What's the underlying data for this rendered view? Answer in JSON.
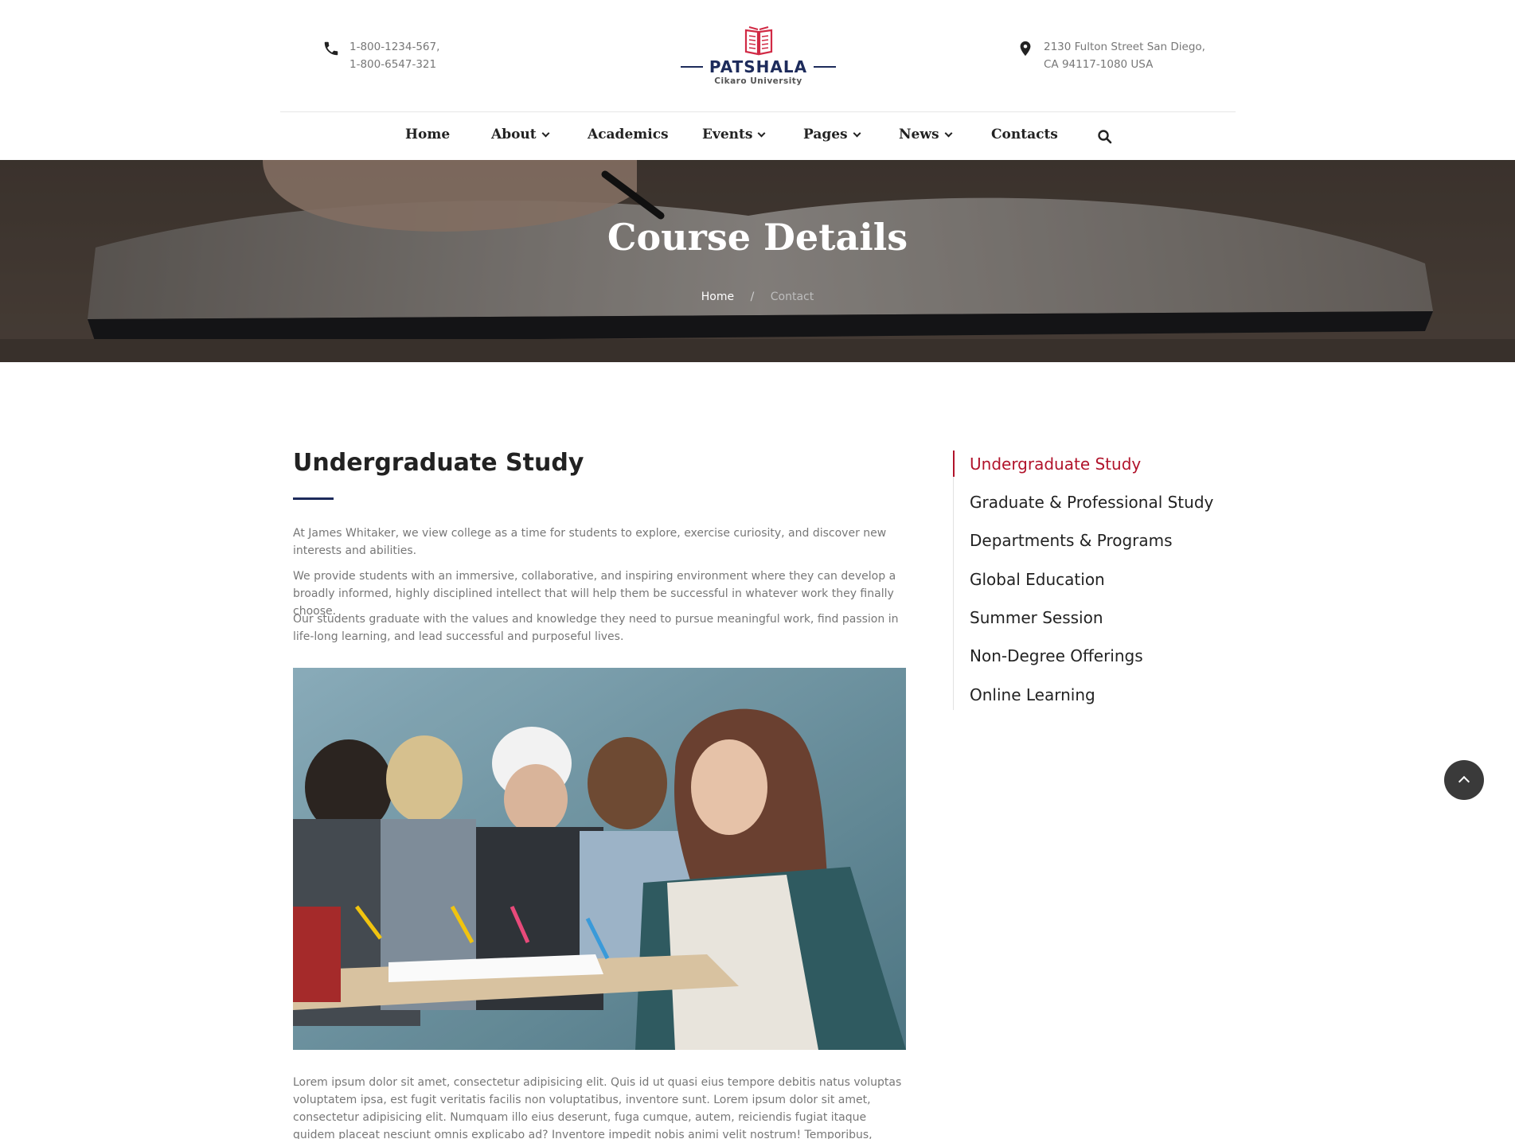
{
  "header": {
    "phone_lines": [
      "1-800-1234-567,",
      "1-800-6547-321"
    ],
    "address_lines": [
      "2130 Fulton Street San Diego,",
      "CA 94117-1080 USA"
    ],
    "logo_name": "PATSHALA",
    "logo_tagline": "Cikaro University",
    "phone_icon": "phone-icon",
    "address_icon": "map-pin-icon",
    "brand_color": "#1d2b5b",
    "accent_color": "#d12a45"
  },
  "nav": {
    "items": [
      {
        "label": "Home",
        "dropdown": false
      },
      {
        "label": "About",
        "dropdown": true
      },
      {
        "label": "Academics",
        "dropdown": false
      },
      {
        "label": "Events",
        "dropdown": true
      },
      {
        "label": "Pages",
        "dropdown": true
      },
      {
        "label": "News",
        "dropdown": true
      },
      {
        "label": "Contacts",
        "dropdown": false
      }
    ],
    "search_icon": "search-icon"
  },
  "hero": {
    "title": "Course Details",
    "breadcrumb": {
      "home": "Home",
      "separator": "/",
      "current": "Contact"
    }
  },
  "main": {
    "title": "Undergraduate Study",
    "paragraphs": [
      "At James Whitaker, we view college as a time for students to explore, exercise curiosity, and discover new interests and abilities.",
      "We provide students with an immersive, collaborative, and inspiring environment where they can develop a broadly informed, highly disciplined intellect that will help them be successful in whatever work they finally choose.",
      "Our students graduate with the values and knowledge they need to pursue meaningful work, find passion in life-long learning, and lead successful and purposeful lives."
    ],
    "body_text": "Lorem ipsum dolor sit amet, consectetur adipisicing elit. Quis id ut quasi eius tempore debitis natus voluptas voluptatem ipsa, est fugit veritatis facilis non voluptatibus, inventore sunt. Lorem ipsum dolor sit amet, consectetur adipisicing elit. Numquam illo eius deserunt, fuga cumque, autem, reiciendis fugiat itaque quidem placeat nesciunt omnis explicabo ad? Inventore impedit nobis animi velit nostrum! Temporibus, voluptatibus, sequi."
  },
  "sidebar": {
    "items": [
      {
        "label": "Undergraduate Study",
        "active": true
      },
      {
        "label": "Graduate & Professional Study",
        "active": false
      },
      {
        "label": "Departments & Programs",
        "active": false
      },
      {
        "label": "Global Education",
        "active": false
      },
      {
        "label": "Summer Session",
        "active": false
      },
      {
        "label": "Non-Degree Offerings",
        "active": false
      },
      {
        "label": "Online Learning",
        "active": false
      }
    ],
    "active_color": "#b1132b"
  },
  "back_to_top_icon": "chevron-up-icon"
}
